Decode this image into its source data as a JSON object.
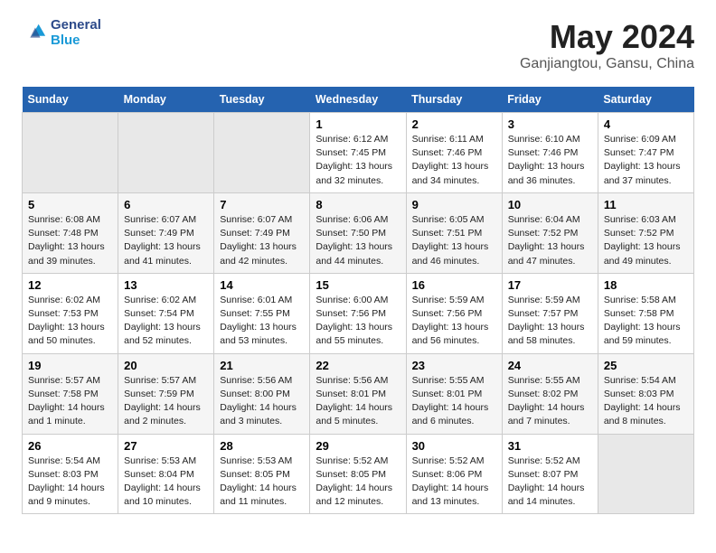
{
  "header": {
    "logo_line1": "General",
    "logo_line2": "Blue",
    "title": "May 2024",
    "subtitle": "Ganjiangtou, Gansu, China"
  },
  "days_of_week": [
    "Sunday",
    "Monday",
    "Tuesday",
    "Wednesday",
    "Thursday",
    "Friday",
    "Saturday"
  ],
  "weeks": [
    [
      {
        "day": null
      },
      {
        "day": null
      },
      {
        "day": null
      },
      {
        "day": "1",
        "sunrise": "6:12 AM",
        "sunset": "7:45 PM",
        "daylight": "13 hours and 32 minutes."
      },
      {
        "day": "2",
        "sunrise": "6:11 AM",
        "sunset": "7:46 PM",
        "daylight": "13 hours and 34 minutes."
      },
      {
        "day": "3",
        "sunrise": "6:10 AM",
        "sunset": "7:46 PM",
        "daylight": "13 hours and 36 minutes."
      },
      {
        "day": "4",
        "sunrise": "6:09 AM",
        "sunset": "7:47 PM",
        "daylight": "13 hours and 37 minutes."
      }
    ],
    [
      {
        "day": "5",
        "sunrise": "6:08 AM",
        "sunset": "7:48 PM",
        "daylight": "13 hours and 39 minutes."
      },
      {
        "day": "6",
        "sunrise": "6:07 AM",
        "sunset": "7:49 PM",
        "daylight": "13 hours and 41 minutes."
      },
      {
        "day": "7",
        "sunrise": "6:07 AM",
        "sunset": "7:49 PM",
        "daylight": "13 hours and 42 minutes."
      },
      {
        "day": "8",
        "sunrise": "6:06 AM",
        "sunset": "7:50 PM",
        "daylight": "13 hours and 44 minutes."
      },
      {
        "day": "9",
        "sunrise": "6:05 AM",
        "sunset": "7:51 PM",
        "daylight": "13 hours and 46 minutes."
      },
      {
        "day": "10",
        "sunrise": "6:04 AM",
        "sunset": "7:52 PM",
        "daylight": "13 hours and 47 minutes."
      },
      {
        "day": "11",
        "sunrise": "6:03 AM",
        "sunset": "7:52 PM",
        "daylight": "13 hours and 49 minutes."
      }
    ],
    [
      {
        "day": "12",
        "sunrise": "6:02 AM",
        "sunset": "7:53 PM",
        "daylight": "13 hours and 50 minutes."
      },
      {
        "day": "13",
        "sunrise": "6:02 AM",
        "sunset": "7:54 PM",
        "daylight": "13 hours and 52 minutes."
      },
      {
        "day": "14",
        "sunrise": "6:01 AM",
        "sunset": "7:55 PM",
        "daylight": "13 hours and 53 minutes."
      },
      {
        "day": "15",
        "sunrise": "6:00 AM",
        "sunset": "7:56 PM",
        "daylight": "13 hours and 55 minutes."
      },
      {
        "day": "16",
        "sunrise": "5:59 AM",
        "sunset": "7:56 PM",
        "daylight": "13 hours and 56 minutes."
      },
      {
        "day": "17",
        "sunrise": "5:59 AM",
        "sunset": "7:57 PM",
        "daylight": "13 hours and 58 minutes."
      },
      {
        "day": "18",
        "sunrise": "5:58 AM",
        "sunset": "7:58 PM",
        "daylight": "13 hours and 59 minutes."
      }
    ],
    [
      {
        "day": "19",
        "sunrise": "5:57 AM",
        "sunset": "7:58 PM",
        "daylight": "14 hours and 1 minute."
      },
      {
        "day": "20",
        "sunrise": "5:57 AM",
        "sunset": "7:59 PM",
        "daylight": "14 hours and 2 minutes."
      },
      {
        "day": "21",
        "sunrise": "5:56 AM",
        "sunset": "8:00 PM",
        "daylight": "14 hours and 3 minutes."
      },
      {
        "day": "22",
        "sunrise": "5:56 AM",
        "sunset": "8:01 PM",
        "daylight": "14 hours and 5 minutes."
      },
      {
        "day": "23",
        "sunrise": "5:55 AM",
        "sunset": "8:01 PM",
        "daylight": "14 hours and 6 minutes."
      },
      {
        "day": "24",
        "sunrise": "5:55 AM",
        "sunset": "8:02 PM",
        "daylight": "14 hours and 7 minutes."
      },
      {
        "day": "25",
        "sunrise": "5:54 AM",
        "sunset": "8:03 PM",
        "daylight": "14 hours and 8 minutes."
      }
    ],
    [
      {
        "day": "26",
        "sunrise": "5:54 AM",
        "sunset": "8:03 PM",
        "daylight": "14 hours and 9 minutes."
      },
      {
        "day": "27",
        "sunrise": "5:53 AM",
        "sunset": "8:04 PM",
        "daylight": "14 hours and 10 minutes."
      },
      {
        "day": "28",
        "sunrise": "5:53 AM",
        "sunset": "8:05 PM",
        "daylight": "14 hours and 11 minutes."
      },
      {
        "day": "29",
        "sunrise": "5:52 AM",
        "sunset": "8:05 PM",
        "daylight": "14 hours and 12 minutes."
      },
      {
        "day": "30",
        "sunrise": "5:52 AM",
        "sunset": "8:06 PM",
        "daylight": "14 hours and 13 minutes."
      },
      {
        "day": "31",
        "sunrise": "5:52 AM",
        "sunset": "8:07 PM",
        "daylight": "14 hours and 14 minutes."
      },
      {
        "day": null
      }
    ]
  ],
  "labels": {
    "sunrise": "Sunrise:",
    "sunset": "Sunset:",
    "daylight": "Daylight:"
  }
}
